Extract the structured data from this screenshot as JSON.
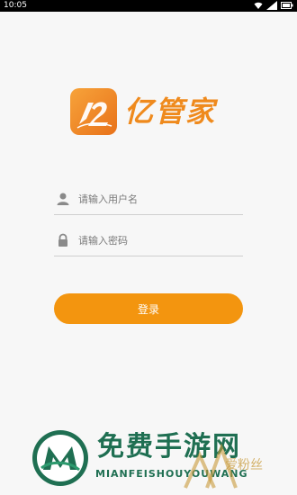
{
  "status_bar": {
    "time": "10:05"
  },
  "app": {
    "name": "亿管家",
    "logo_icon": "stylized-12-logo-icon",
    "accent": "#f3950f"
  },
  "form": {
    "username_placeholder": "请输入用户名",
    "password_placeholder": "请输入密码",
    "login_label": "登录"
  },
  "watermark": {
    "title": "免费手游网",
    "subtitle": "MIANFEISHOUYOUWANG",
    "side_text": "爱粉丝"
  }
}
